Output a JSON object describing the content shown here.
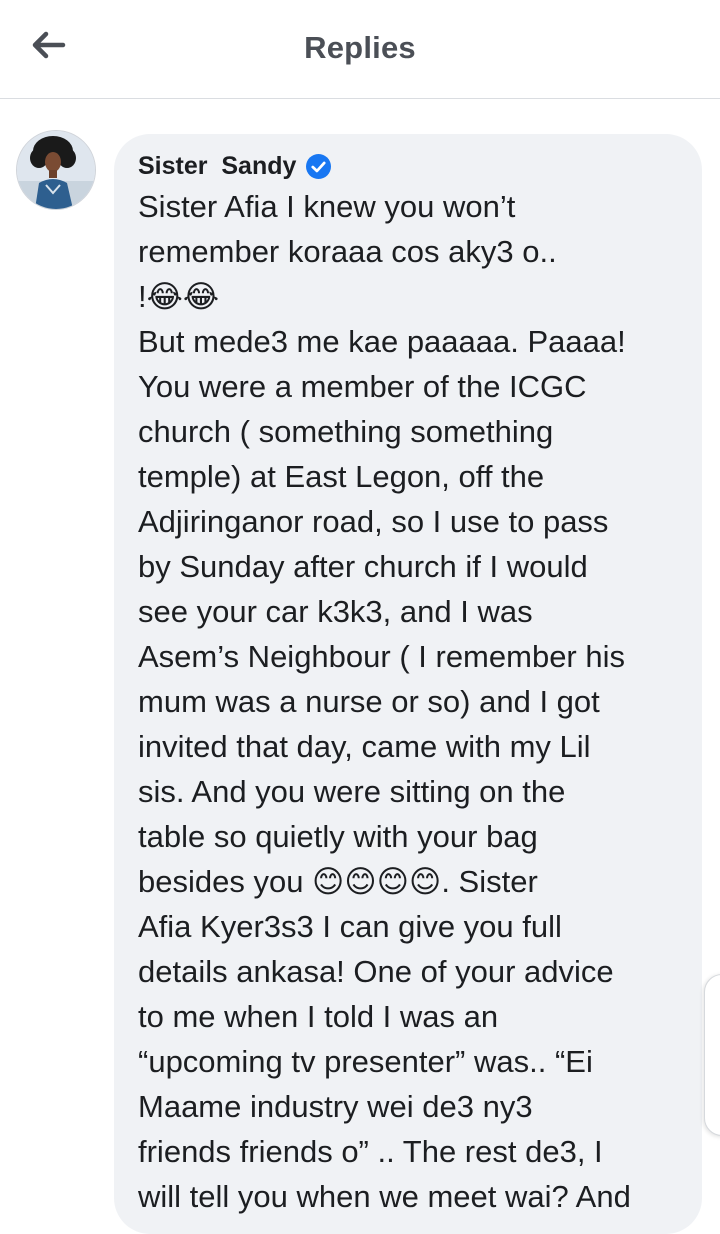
{
  "header": {
    "title": "Replies",
    "back_icon": "arrow-left-icon"
  },
  "comment": {
    "author": "Sister  Sandy",
    "verified": true,
    "verified_color": "#1877f2",
    "text": "Sister Afia I knew you won’t\nremember koraaa cos aky3 o..\n!😂😂\nBut mede3 me kae paaaaa. Paaaa!\nYou were a member of the ICGC\nchurch ( something something\ntemple) at East Legon, off the\nAdjiringanor road, so I use to pass\nby Sunday after church if I would\nsee your car k3k3, and I was\nAsem’s Neighbour ( I remember his\nmum was a nurse or so) and I got\ninvited that day, came with my Lil\nsis. And you were sitting on the\ntable so quietly with your bag\nbesides you 😊😊😊😊. Sister\nAfia Kyer3s3 I can give you full\ndetails ankasa! One of your advice\nto me when I told I was an\n“upcoming tv presenter” was.. “Ei\nMaame industry wei de3 ny3\nfriends friends o” .. The rest de3, I\nwill tell you when we meet wai? And"
  },
  "colors": {
    "bubble": "#f0f2f5",
    "text": "#1c1e21",
    "header_title": "#4b4f56"
  }
}
